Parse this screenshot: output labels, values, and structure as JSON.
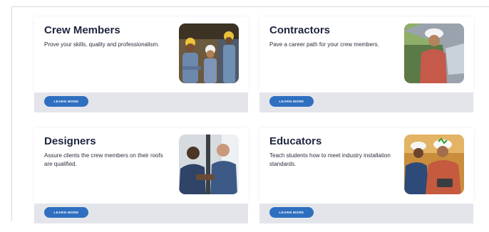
{
  "cards": [
    {
      "title": "Crew Members",
      "description": "Prove your skills, quality and professionalism.",
      "button_label": "LEARN MORE",
      "image": "crew-members-photo"
    },
    {
      "title": "Contractors",
      "description": "Pave a career path for your crew members.",
      "button_label": "LEARN MORE",
      "image": "contractor-photo"
    },
    {
      "title": "Designers",
      "description": "Assure clients the crew members on their roofs are qualified.",
      "button_label": "LEARN MORE",
      "image": "designers-photo"
    },
    {
      "title": "Educators",
      "description": "Teach students how to meet industry installation standards.",
      "button_label": "LEARN MORE",
      "image": "educators-photo"
    }
  ],
  "colors": {
    "title": "#1f2540",
    "button": "#2f6fc0",
    "card_footer": "#e3e5ea"
  }
}
